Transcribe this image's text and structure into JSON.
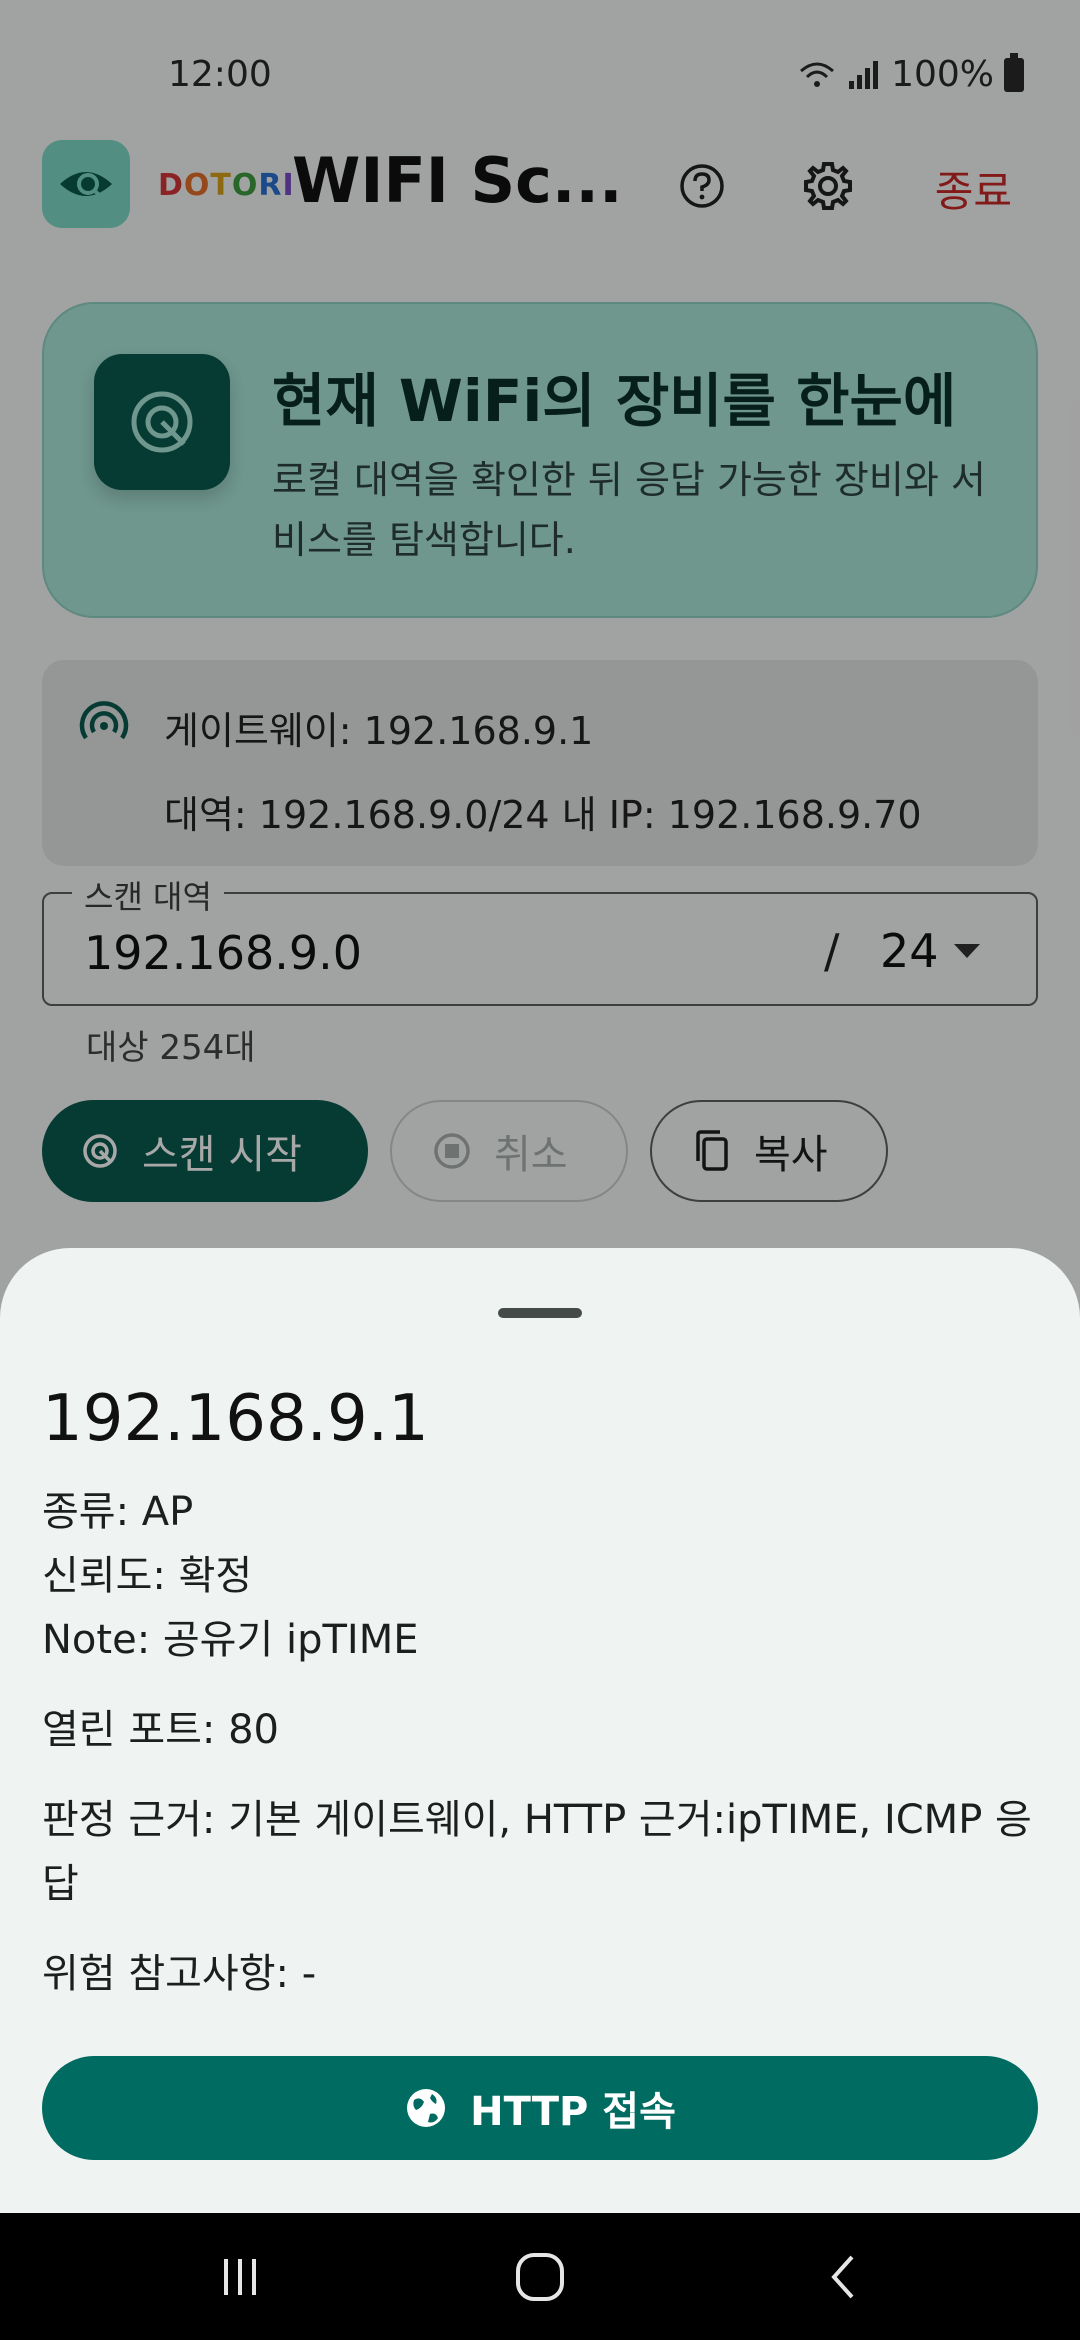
{
  "status_bar": {
    "time": "12:00",
    "battery": "100%"
  },
  "app_bar": {
    "brand_letters": [
      "D",
      "O",
      "T",
      "O",
      "R",
      "I"
    ],
    "title": "WIFI Sc...",
    "exit_label": "종료"
  },
  "hero": {
    "title": "현재 WiFi의 장비를 한눈에",
    "description": "로컬 대역을 확인한 뒤 응답 가능한 장비와 서비스를 탐색합니다."
  },
  "network": {
    "gateway": "게이트웨이: 192.168.9.1",
    "range_and_ip": "대역: 192.168.9.0/24   내 IP: 192.168.9.70"
  },
  "scan_range": {
    "label": "스캔 대역",
    "value": "192.168.9.0",
    "slash": "/",
    "prefix": "24",
    "target_count": "대상 254대"
  },
  "actions": {
    "scan_label": "스캔 시작",
    "cancel_label": "취소",
    "copy_label": "복사"
  },
  "sheet": {
    "title": "192.168.9.1",
    "type": "종류: AP",
    "confidence": "신뢰도: 확정",
    "note": "Note: 공유기 ipTIME",
    "open_ports": "열린 포트: 80",
    "evidence": "판정 근거: 기본 게이트웨이, HTTP 근거:ipTIME, ICMP 응답",
    "risk": "위험 참고사항: -",
    "http_button": "HTTP 접속"
  },
  "colors": {
    "primary": "#0a5a4f",
    "http_button": "#006b61",
    "hero_bg": "#a9e6d8",
    "exit": "#c62828"
  }
}
